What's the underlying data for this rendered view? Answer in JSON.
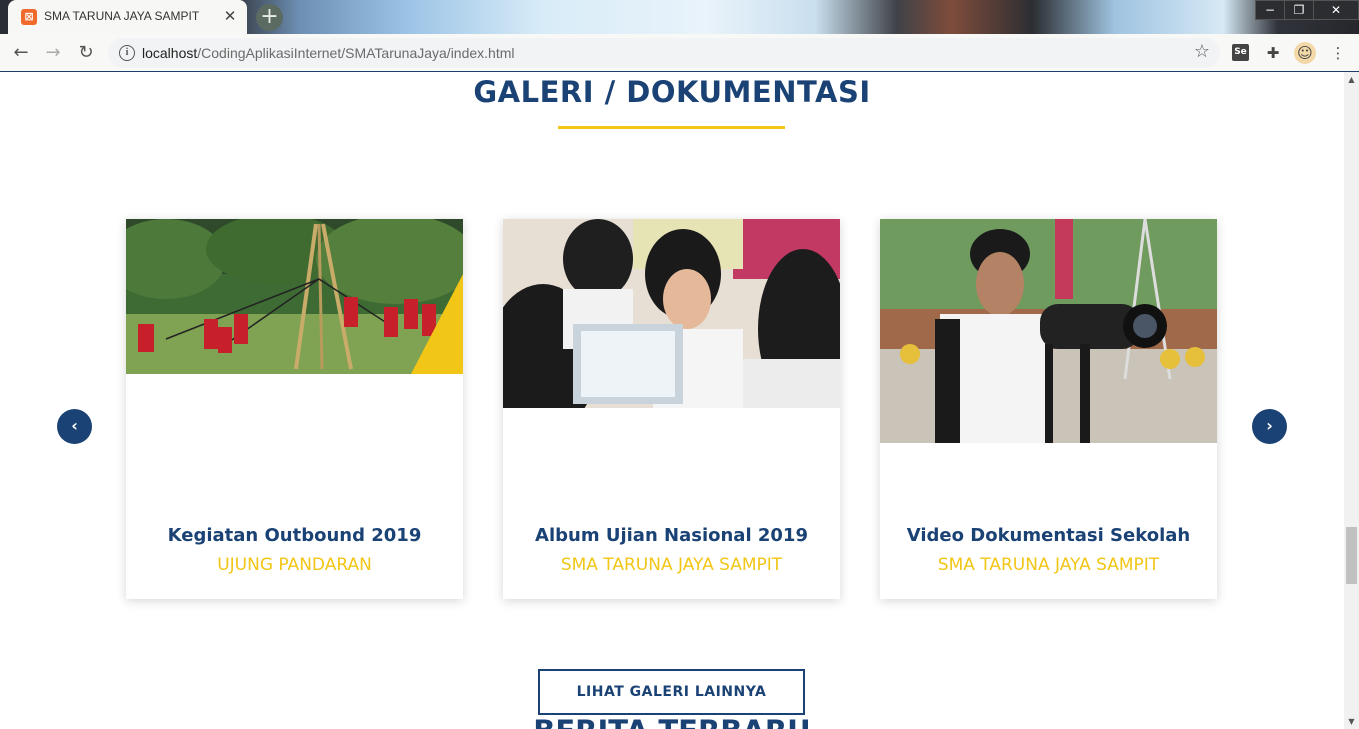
{
  "browser": {
    "tab_title": "SMA TARUNA JAYA SAMPIT",
    "tab_close": "✕",
    "new_tab": "+",
    "url_host": "localhost",
    "url_path": "/CodingAplikasiInternet/SMATarunaJaya/index.html",
    "extension_se_label": "Se"
  },
  "gallery": {
    "title": "GALERI / DOKUMENTASI",
    "accent_color": "#f2c616",
    "primary_color": "#1a4275",
    "cards": [
      {
        "title": "Kegiatan Outbound 2019",
        "subtitle": "UJUNG PANDARAN"
      },
      {
        "title": "Album Ujian Nasional 2019",
        "subtitle": "SMA TARUNA JAYA SAMPIT"
      },
      {
        "title": "Video Dokumentasi Sekolah",
        "subtitle": "SMA TARUNA JAYA SAMPIT"
      }
    ],
    "prev_icon": "‹",
    "next_icon": "›",
    "more_button": "LIHAT GALERI LAINNYA"
  },
  "next_section_title": "BERITA TERBARU"
}
